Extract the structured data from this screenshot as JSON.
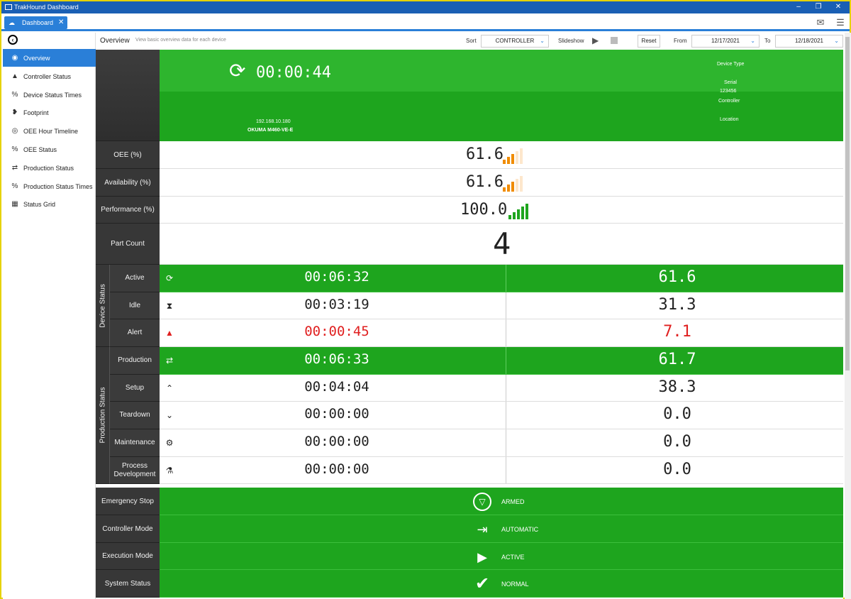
{
  "window": {
    "title": "TrakHound Dashboard"
  },
  "tab": {
    "label": "Dashboard",
    "close": "✕"
  },
  "sidebar": {
    "items": [
      {
        "label": "Overview",
        "icon": "magnifier-icon",
        "glyph": "◉"
      },
      {
        "label": "Controller Status",
        "icon": "warning-triangle-icon",
        "glyph": "▲"
      },
      {
        "label": "Device Status Times",
        "icon": "percent-icon",
        "glyph": "%"
      },
      {
        "label": "Footprint",
        "icon": "footprint-icon",
        "glyph": "❥"
      },
      {
        "label": "OEE Hour Timeline",
        "icon": "magnifier-icon",
        "glyph": "◎"
      },
      {
        "label": "OEE Status",
        "icon": "percent-oee-icon",
        "glyph": "%"
      },
      {
        "label": "Production Status",
        "icon": "swap-arrows-icon",
        "glyph": "⇄"
      },
      {
        "label": "Production Status Times",
        "icon": "percent-swap-icon",
        "glyph": "%"
      },
      {
        "label": "Status Grid",
        "icon": "grid-icon",
        "glyph": "▦"
      }
    ]
  },
  "toolbar": {
    "title": "Overview",
    "subtitle": "View basic overview data for each device",
    "sort_label": "Sort",
    "sort_value": "CONTROLLER",
    "slideshow_label": "Slideshow",
    "reset_label": "Reset",
    "from_label": "From",
    "from_value": "12/17/2021",
    "to_label": "To",
    "to_value": "12/18/2021"
  },
  "device": {
    "timer": "00:00:44",
    "ip": "192.168.10.180",
    "name": "OKUMA M460-VE-E",
    "device_type_label": "Device Type",
    "serial_label": "Serial",
    "serial_value": "123456",
    "controller_label": "Controller",
    "location_label": "Location"
  },
  "metrics": {
    "oee_label": "OEE (%)",
    "oee_value": "61.6",
    "oee_level": 0.6,
    "availability_label": "Availability (%)",
    "availability_value": "61.6",
    "availability_level": 0.6,
    "performance_label": "Performance (%)",
    "performance_value": "100.0",
    "performance_level": 1.0,
    "part_count_label": "Part Count",
    "part_count_value": "4"
  },
  "device_status": {
    "group_label": "Device Status",
    "rows": [
      {
        "label": "Active",
        "time": "00:06:32",
        "pct": "61.6"
      },
      {
        "label": "Idle",
        "time": "00:03:19",
        "pct": "31.3"
      },
      {
        "label": "Alert",
        "time": "00:00:45",
        "pct": "7.1"
      }
    ]
  },
  "production_status": {
    "group_label": "Production Status",
    "rows": [
      {
        "label": "Production",
        "time": "00:06:33",
        "pct": "61.7"
      },
      {
        "label": "Setup",
        "time": "00:04:04",
        "pct": "38.3"
      },
      {
        "label": "Teardown",
        "time": "00:00:00",
        "pct": "0.0"
      },
      {
        "label": "Maintenance",
        "time": "00:00:00",
        "pct": "0.0"
      },
      {
        "label": "Process Development",
        "time": "00:00:00",
        "pct": "0.0"
      }
    ]
  },
  "bottom": {
    "estop_label": "Emergency Stop",
    "estop_value": "ARMED",
    "mode_label": "Controller Mode",
    "mode_value": "AUTOMATIC",
    "exec_label": "Execution Mode",
    "exec_value": "ACTIVE",
    "system_label": "System Status",
    "system_value": "NORMAL"
  },
  "colors": {
    "accent": "#2a7fd8",
    "green": "#1ea51e",
    "dark": "#373737",
    "alert": "#e02020",
    "orange": "#f08c00"
  }
}
